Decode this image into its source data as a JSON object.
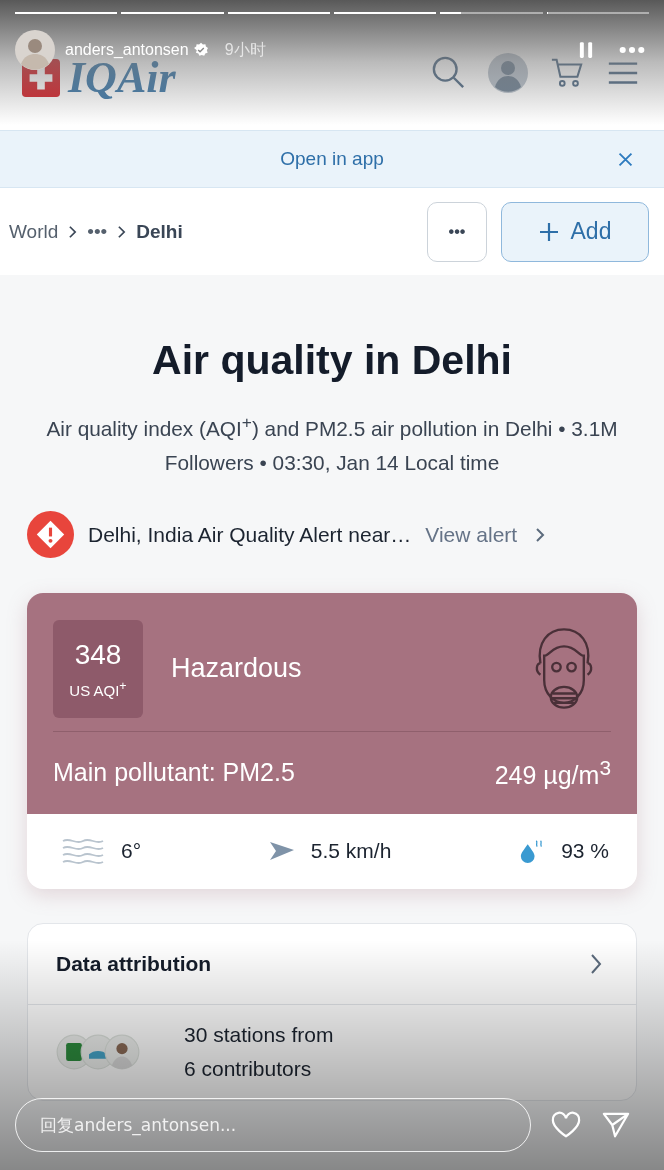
{
  "story": {
    "progress": [
      {
        "level": 1
      },
      {
        "level": 1
      },
      {
        "level": 1
      },
      {
        "level": 1
      },
      {
        "level": 0.2
      },
      {
        "level": 0
      }
    ],
    "username": "anders_antonsen",
    "verified": true,
    "time": "9小时"
  },
  "site_header": {
    "logo": "IQAir"
  },
  "banner": {
    "label": "Open in app"
  },
  "breadcrumb": [
    "World",
    "•••",
    "Delhi"
  ],
  "actions": {
    "more": "•••",
    "add": "Add"
  },
  "title": "Air quality in Delhi",
  "subtitle": "Air quality index (AQI$^{+}$) and PM2.5 air pollution in Delhi • 3.1M Followers • 03:30, Jan 14 Local time",
  "alert": {
    "text": "Delhi, India Air Quality Alert near…",
    "link": "View alert"
  },
  "aqi": {
    "value": "348",
    "unit": "US AQI$^{+}$",
    "status": "Hazardous",
    "pollutant": "Main pollutant: PM2.5",
    "concentration": "249 µg/m$^{3}$"
  },
  "weather": [
    {
      "kind": "temperature",
      "value": "6°"
    },
    {
      "kind": "wind",
      "value": "5.5 km/h"
    },
    {
      "kind": "humidity",
      "value": "93 %"
    }
  ],
  "attribution": {
    "title": "Data attribution",
    "summary": [
      "30 stations from",
      "6 contributors"
    ]
  },
  "reply": {
    "placeholder": "回复anders_antonsen..."
  }
}
